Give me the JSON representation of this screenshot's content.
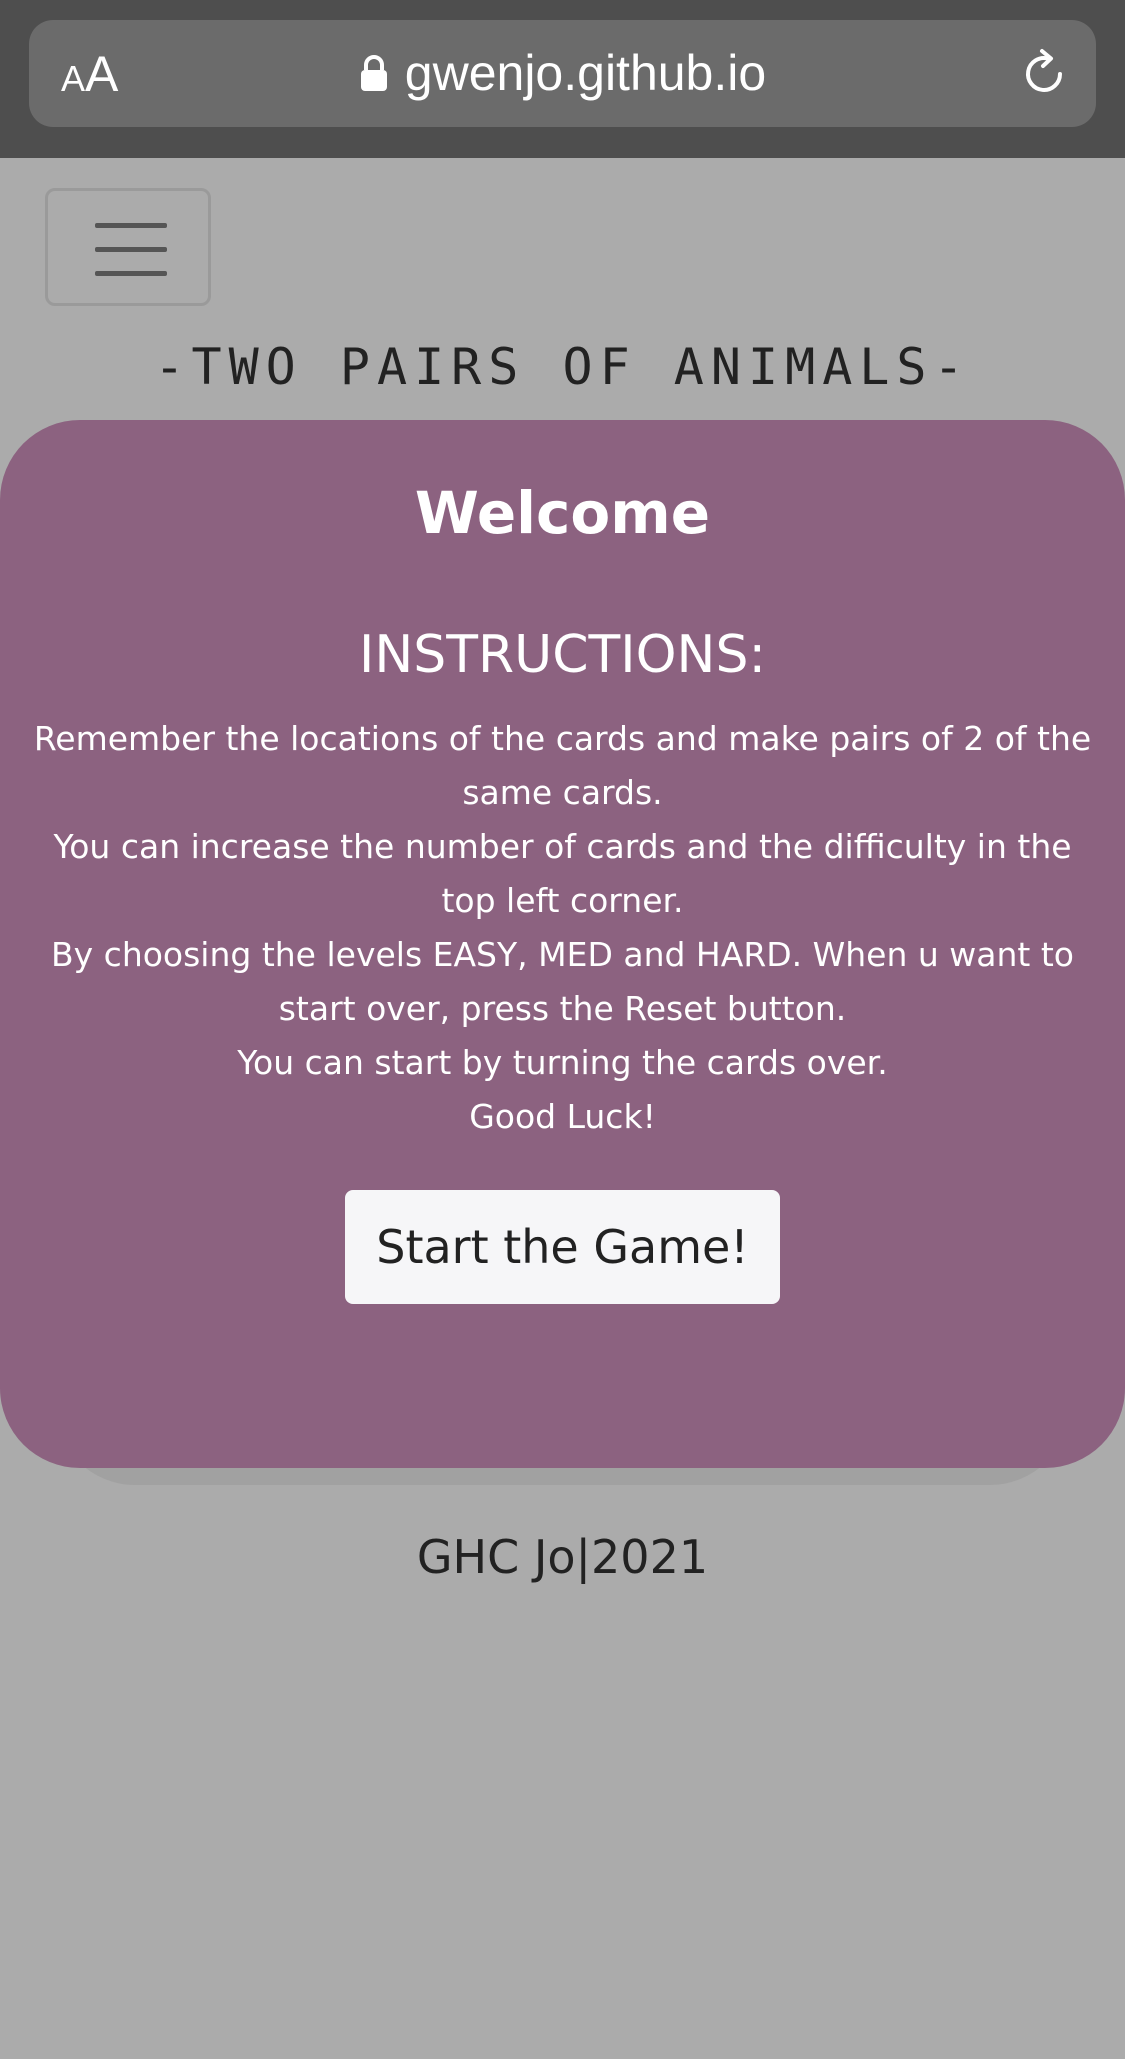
{
  "browser": {
    "text_size_small": "A",
    "text_size_large": "A",
    "url": "gwenjo.github.io",
    "colors": {
      "toolbar": "#4e4e4e",
      "url_field": "#6b6b6b"
    }
  },
  "nav": {
    "menu_icon": "hamburger-menu-icon"
  },
  "header": {
    "title": "-TWO PAIRS OF ANIMALS-"
  },
  "modal": {
    "heading": "Welcome",
    "instructions_title": "INSTRUCTIONS:",
    "lines": [
      "Remember the locations of the cards and make pairs of 2 of the same cards.",
      "You can increase the number of cards and the difficulty in the top left corner.",
      "By choosing the levels EASY, MED and HARD. When u want to start over, press the Reset button.",
      "You can start by turning the cards over.",
      "Good Luck!"
    ],
    "start_button_label": "Start the Game!",
    "colors": {
      "background": "#8c6280",
      "button": "#f6f6f8"
    }
  },
  "footer": {
    "text": "GHC Jo|2021"
  },
  "colors": {
    "page_background": "#ababab"
  }
}
